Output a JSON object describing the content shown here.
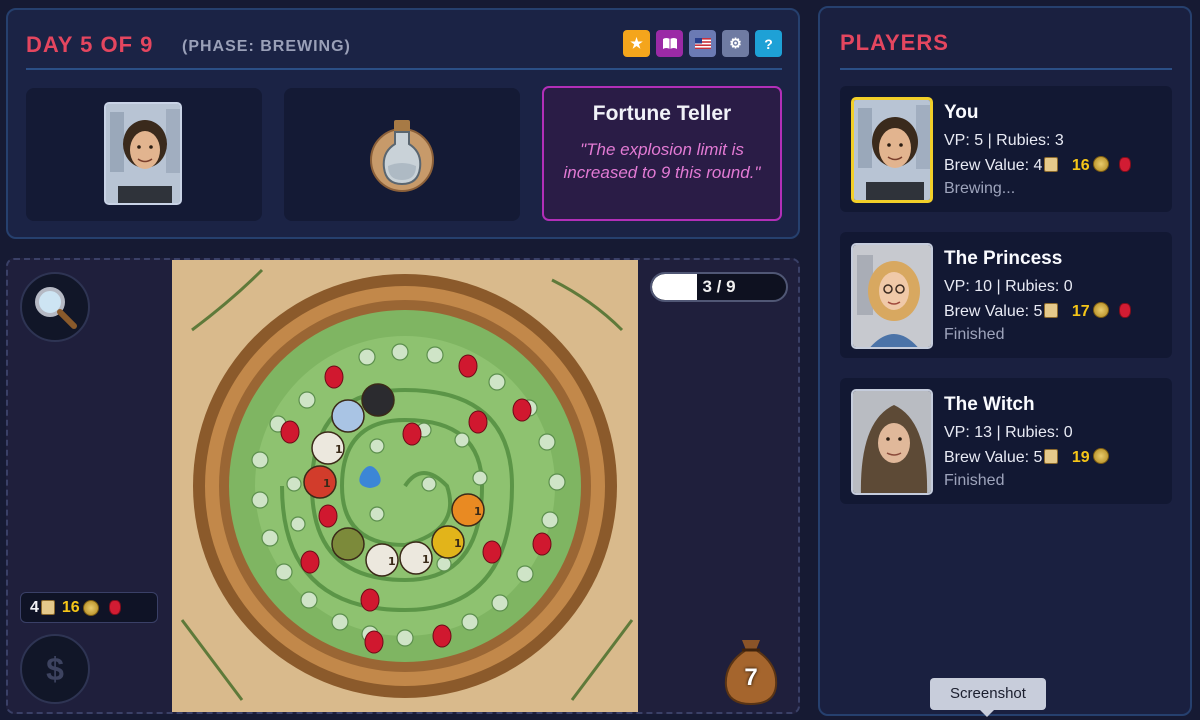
{
  "header": {
    "day_title": "DAY 5 OF 9",
    "phase": "(PHASE: BREWING)",
    "icons": [
      {
        "name": "star-icon",
        "glyph": "★",
        "color": "#f4a51c"
      },
      {
        "name": "rulebook-icon",
        "glyph": "📖",
        "color": "#9b2aa6"
      },
      {
        "name": "language-flag-icon",
        "glyph": "🇺🇸",
        "color": "#6b7ab4"
      },
      {
        "name": "gear-icon",
        "glyph": "⚙",
        "color": "#6f7ba2"
      },
      {
        "name": "help-icon",
        "glyph": "?",
        "color": "#1ea1d6"
      }
    ]
  },
  "fortune": {
    "title": "Fortune Teller",
    "text": "\"The explosion limit is increased to 9 this round.\""
  },
  "board": {
    "progress": {
      "current": 3,
      "max": 9,
      "label": "3 / 9"
    },
    "resources": {
      "vp": "4",
      "coins": "16"
    },
    "bag_count": "7",
    "dollar_symbol": "$"
  },
  "players": {
    "title": "PLAYERS",
    "list": [
      {
        "name": "You",
        "stats": "VP: 5 | Rubies: 3",
        "brew_label": "Brew Value: 4",
        "coins": "16",
        "has_ruby": true,
        "status": "Brewing...",
        "active": true
      },
      {
        "name": "The Princess",
        "stats": "VP: 10 | Rubies: 0",
        "brew_label": "Brew Value: 5",
        "coins": "17",
        "has_ruby": true,
        "status": "Finished",
        "active": false
      },
      {
        "name": "The Witch",
        "stats": "VP: 13 | Rubies: 0",
        "brew_label": "Brew Value: 5",
        "coins": "19",
        "has_ruby": false,
        "status": "Finished",
        "active": false
      }
    ]
  },
  "tooltip": "Screenshot"
}
